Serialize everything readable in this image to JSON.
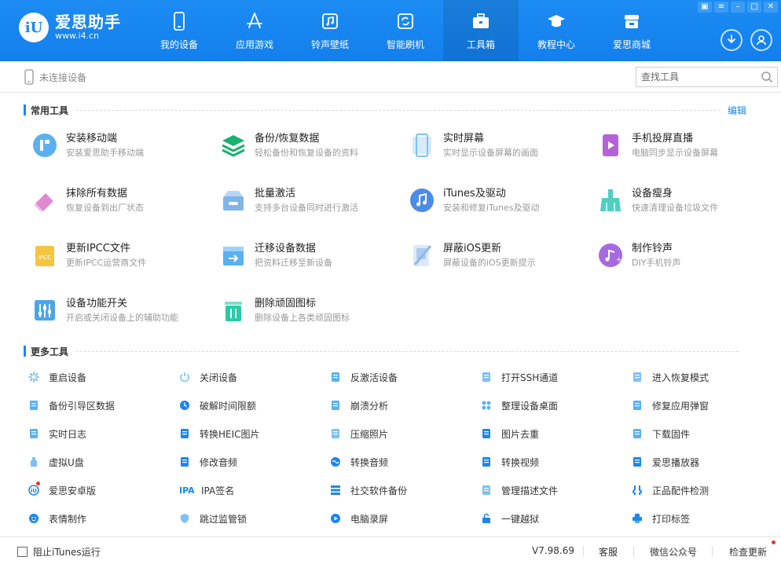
{
  "app": {
    "logo_badge": "iU",
    "name": "爱思助手",
    "url": "www.i4.cn"
  },
  "nav": [
    {
      "label": "我的设备",
      "icon": "phone-icon"
    },
    {
      "label": "应用游戏",
      "icon": "app-store-icon"
    },
    {
      "label": "铃声壁纸",
      "icon": "music-note-icon"
    },
    {
      "label": "智能刷机",
      "icon": "refresh-icon"
    },
    {
      "label": "工具箱",
      "icon": "toolbox-icon",
      "active": true
    },
    {
      "label": "教程中心",
      "icon": "graduation-cap-icon"
    },
    {
      "label": "爱思商城",
      "icon": "store-icon"
    }
  ],
  "subbar": {
    "device_status": "未连接设备",
    "search_placeholder": "查找工具"
  },
  "common": {
    "title": "常用工具",
    "edit": "编辑",
    "tools": [
      {
        "name": "安装移动端",
        "desc": "安装爱思助手移动端",
        "icon": "mobile-app-icon",
        "color": "#5ab0f0"
      },
      {
        "name": "备份/恢复数据",
        "desc": "轻松备份和恢复设备的资料",
        "icon": "layers-icon",
        "color": "#18b26d"
      },
      {
        "name": "实时屏幕",
        "desc": "实时显示设备屏幕的画面",
        "icon": "screen-icon",
        "color": "#7ec0f5"
      },
      {
        "name": "手机投屏直播",
        "desc": "电脑同步显示设备屏幕",
        "icon": "screencast-icon",
        "color": "#b561d8"
      },
      {
        "name": "抹除所有数据",
        "desc": "恢复设备到出厂状态",
        "icon": "eraser-icon",
        "color": "#e08ad0"
      },
      {
        "name": "批量激活",
        "desc": "支持多台设备同时进行激活",
        "icon": "batch-activate-icon",
        "color": "#7fb4e8"
      },
      {
        "name": "iTunes及驱动",
        "desc": "安装和修复iTunes及驱动",
        "icon": "itunes-icon",
        "color": "#4c8be8"
      },
      {
        "name": "设备瘦身",
        "desc": "快速清理设备垃圾文件",
        "icon": "broom-icon",
        "color": "#4fd0c0"
      },
      {
        "name": "更新IPCC文件",
        "desc": "更新IPCC运营商文件",
        "icon": "ipcc-file-icon",
        "color": "#f5c542"
      },
      {
        "name": "迁移设备数据",
        "desc": "把资料迁移至新设备",
        "icon": "migrate-icon",
        "color": "#5ab0f0"
      },
      {
        "name": "屏蔽iOS更新",
        "desc": "屏蔽设备的iOS更新提示",
        "icon": "block-update-icon",
        "color": "#8fb8ea"
      },
      {
        "name": "制作铃声",
        "desc": "DIY手机铃声",
        "icon": "ringtone-icon",
        "color": "#a66ae0"
      },
      {
        "name": "设备功能开关",
        "desc": "开启或关闭设备上的辅助功能",
        "icon": "sliders-icon",
        "color": "#4aa6ea"
      },
      {
        "name": "删除顽固图标",
        "desc": "删除设备上各类顽固图标",
        "icon": "trash-icon",
        "color": "#2cc9a5"
      }
    ]
  },
  "more": {
    "title": "更多工具",
    "tools": [
      {
        "name": "重启设备",
        "icon": "restart-icon",
        "color": "#5ab0f0"
      },
      {
        "name": "关闭设备",
        "icon": "power-icon",
        "color": "#7ec0f5"
      },
      {
        "name": "反激活设备",
        "icon": "deactivate-icon",
        "color": "#5ab0f0"
      },
      {
        "name": "打开SSH通道",
        "icon": "ssh-icon",
        "color": "#7ec0f5"
      },
      {
        "name": "进入恢复模式",
        "icon": "recovery-icon",
        "color": "#7ec0f5"
      },
      {
        "name": "备份引导区数据",
        "icon": "backup-boot-icon",
        "color": "#5ab0f0"
      },
      {
        "name": "破解时间限额",
        "icon": "clock-icon",
        "color": "#1a86f0"
      },
      {
        "name": "崩溃分析",
        "icon": "crash-analysis-icon",
        "color": "#5ab0f0"
      },
      {
        "name": "整理设备桌面",
        "icon": "desktop-grid-icon",
        "color": "#5ab0f0"
      },
      {
        "name": "修复应用弹窗",
        "icon": "repair-popup-icon",
        "color": "#5ab0f0"
      },
      {
        "name": "实时日志",
        "icon": "log-icon",
        "color": "#5ab0f0"
      },
      {
        "name": "转换HEIC图片",
        "icon": "heic-convert-icon",
        "color": "#1a86f0"
      },
      {
        "name": "压缩照片",
        "icon": "compress-photo-icon",
        "color": "#7ec0f5"
      },
      {
        "name": "图片去重",
        "icon": "dedupe-image-icon",
        "color": "#1a86f0"
      },
      {
        "name": "下载固件",
        "icon": "download-firmware-icon",
        "color": "#5ab0f0"
      },
      {
        "name": "虚拟U盘",
        "icon": "usb-drive-icon",
        "color": "#7ec0f5"
      },
      {
        "name": "修改音频",
        "icon": "edit-audio-icon",
        "color": "#1a86f0"
      },
      {
        "name": "转换音频",
        "icon": "convert-audio-icon",
        "color": "#1a86f0"
      },
      {
        "name": "转换视频",
        "icon": "convert-video-icon",
        "color": "#1a86f0"
      },
      {
        "name": "爱思播放器",
        "icon": "player-icon",
        "color": "#1a86f0"
      },
      {
        "name": "爱思安卓版",
        "icon": "i4-android-icon",
        "color": "#1a86f0",
        "dot": true
      },
      {
        "name": "IPA签名",
        "icon": "ipa-sign-icon",
        "color": "#1a86f0",
        "prefix": "IPA"
      },
      {
        "name": "社交软件备份",
        "icon": "social-backup-icon",
        "color": "#1a86f0"
      },
      {
        "name": "管理描述文件",
        "icon": "profile-icon",
        "color": "#7ec0f5"
      },
      {
        "name": "正品配件检测",
        "icon": "accessory-check-icon",
        "color": "#1a86f0"
      },
      {
        "name": "表情制作",
        "icon": "emoji-icon",
        "color": "#1a86f0"
      },
      {
        "name": "跳过监管锁",
        "icon": "shield-icon",
        "color": "#7ec0f5"
      },
      {
        "name": "电脑录屏",
        "icon": "record-icon",
        "color": "#1a86f0"
      },
      {
        "name": "一键越狱",
        "icon": "unlock-icon",
        "color": "#1a86f0"
      },
      {
        "name": "打印标签",
        "icon": "printer-icon",
        "color": "#1a86f0"
      }
    ]
  },
  "footer": {
    "block_itunes": "阻止iTunes运行",
    "version": "V7.98.69",
    "service": "客服",
    "wechat": "微信公众号",
    "update": "检查更新"
  },
  "colors": {
    "accent": "#1a86f0",
    "header": "#1585ee",
    "dot": "#f03030"
  }
}
